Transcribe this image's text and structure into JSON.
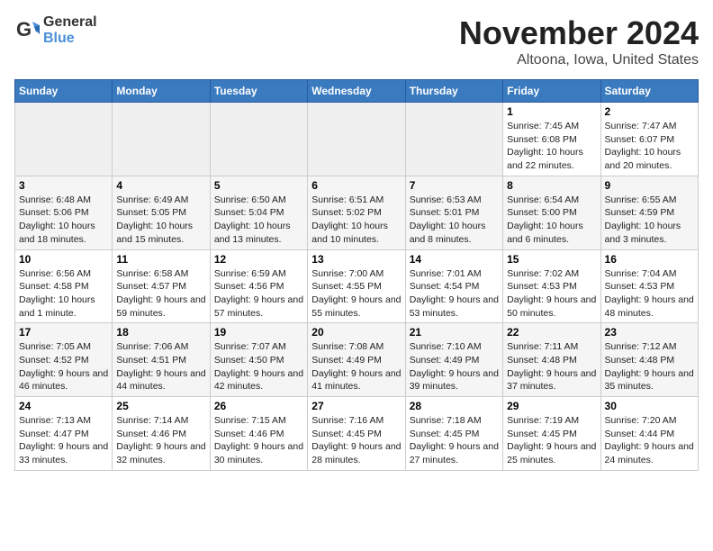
{
  "logo": {
    "text_general": "General",
    "text_blue": "Blue"
  },
  "header": {
    "month_title": "November 2024",
    "location": "Altoona, Iowa, United States"
  },
  "weekdays": [
    "Sunday",
    "Monday",
    "Tuesday",
    "Wednesday",
    "Thursday",
    "Friday",
    "Saturday"
  ],
  "weeks": [
    [
      {
        "day": "",
        "info": ""
      },
      {
        "day": "",
        "info": ""
      },
      {
        "day": "",
        "info": ""
      },
      {
        "day": "",
        "info": ""
      },
      {
        "day": "",
        "info": ""
      },
      {
        "day": "1",
        "info": "Sunrise: 7:45 AM\nSunset: 6:08 PM\nDaylight: 10 hours and 22 minutes."
      },
      {
        "day": "2",
        "info": "Sunrise: 7:47 AM\nSunset: 6:07 PM\nDaylight: 10 hours and 20 minutes."
      }
    ],
    [
      {
        "day": "3",
        "info": "Sunrise: 6:48 AM\nSunset: 5:06 PM\nDaylight: 10 hours and 18 minutes."
      },
      {
        "day": "4",
        "info": "Sunrise: 6:49 AM\nSunset: 5:05 PM\nDaylight: 10 hours and 15 minutes."
      },
      {
        "day": "5",
        "info": "Sunrise: 6:50 AM\nSunset: 5:04 PM\nDaylight: 10 hours and 13 minutes."
      },
      {
        "day": "6",
        "info": "Sunrise: 6:51 AM\nSunset: 5:02 PM\nDaylight: 10 hours and 10 minutes."
      },
      {
        "day": "7",
        "info": "Sunrise: 6:53 AM\nSunset: 5:01 PM\nDaylight: 10 hours and 8 minutes."
      },
      {
        "day": "8",
        "info": "Sunrise: 6:54 AM\nSunset: 5:00 PM\nDaylight: 10 hours and 6 minutes."
      },
      {
        "day": "9",
        "info": "Sunrise: 6:55 AM\nSunset: 4:59 PM\nDaylight: 10 hours and 3 minutes."
      }
    ],
    [
      {
        "day": "10",
        "info": "Sunrise: 6:56 AM\nSunset: 4:58 PM\nDaylight: 10 hours and 1 minute."
      },
      {
        "day": "11",
        "info": "Sunrise: 6:58 AM\nSunset: 4:57 PM\nDaylight: 9 hours and 59 minutes."
      },
      {
        "day": "12",
        "info": "Sunrise: 6:59 AM\nSunset: 4:56 PM\nDaylight: 9 hours and 57 minutes."
      },
      {
        "day": "13",
        "info": "Sunrise: 7:00 AM\nSunset: 4:55 PM\nDaylight: 9 hours and 55 minutes."
      },
      {
        "day": "14",
        "info": "Sunrise: 7:01 AM\nSunset: 4:54 PM\nDaylight: 9 hours and 53 minutes."
      },
      {
        "day": "15",
        "info": "Sunrise: 7:02 AM\nSunset: 4:53 PM\nDaylight: 9 hours and 50 minutes."
      },
      {
        "day": "16",
        "info": "Sunrise: 7:04 AM\nSunset: 4:53 PM\nDaylight: 9 hours and 48 minutes."
      }
    ],
    [
      {
        "day": "17",
        "info": "Sunrise: 7:05 AM\nSunset: 4:52 PM\nDaylight: 9 hours and 46 minutes."
      },
      {
        "day": "18",
        "info": "Sunrise: 7:06 AM\nSunset: 4:51 PM\nDaylight: 9 hours and 44 minutes."
      },
      {
        "day": "19",
        "info": "Sunrise: 7:07 AM\nSunset: 4:50 PM\nDaylight: 9 hours and 42 minutes."
      },
      {
        "day": "20",
        "info": "Sunrise: 7:08 AM\nSunset: 4:49 PM\nDaylight: 9 hours and 41 minutes."
      },
      {
        "day": "21",
        "info": "Sunrise: 7:10 AM\nSunset: 4:49 PM\nDaylight: 9 hours and 39 minutes."
      },
      {
        "day": "22",
        "info": "Sunrise: 7:11 AM\nSunset: 4:48 PM\nDaylight: 9 hours and 37 minutes."
      },
      {
        "day": "23",
        "info": "Sunrise: 7:12 AM\nSunset: 4:48 PM\nDaylight: 9 hours and 35 minutes."
      }
    ],
    [
      {
        "day": "24",
        "info": "Sunrise: 7:13 AM\nSunset: 4:47 PM\nDaylight: 9 hours and 33 minutes."
      },
      {
        "day": "25",
        "info": "Sunrise: 7:14 AM\nSunset: 4:46 PM\nDaylight: 9 hours and 32 minutes."
      },
      {
        "day": "26",
        "info": "Sunrise: 7:15 AM\nSunset: 4:46 PM\nDaylight: 9 hours and 30 minutes."
      },
      {
        "day": "27",
        "info": "Sunrise: 7:16 AM\nSunset: 4:45 PM\nDaylight: 9 hours and 28 minutes."
      },
      {
        "day": "28",
        "info": "Sunrise: 7:18 AM\nSunset: 4:45 PM\nDaylight: 9 hours and 27 minutes."
      },
      {
        "day": "29",
        "info": "Sunrise: 7:19 AM\nSunset: 4:45 PM\nDaylight: 9 hours and 25 minutes."
      },
      {
        "day": "30",
        "info": "Sunrise: 7:20 AM\nSunset: 4:44 PM\nDaylight: 9 hours and 24 minutes."
      }
    ]
  ]
}
